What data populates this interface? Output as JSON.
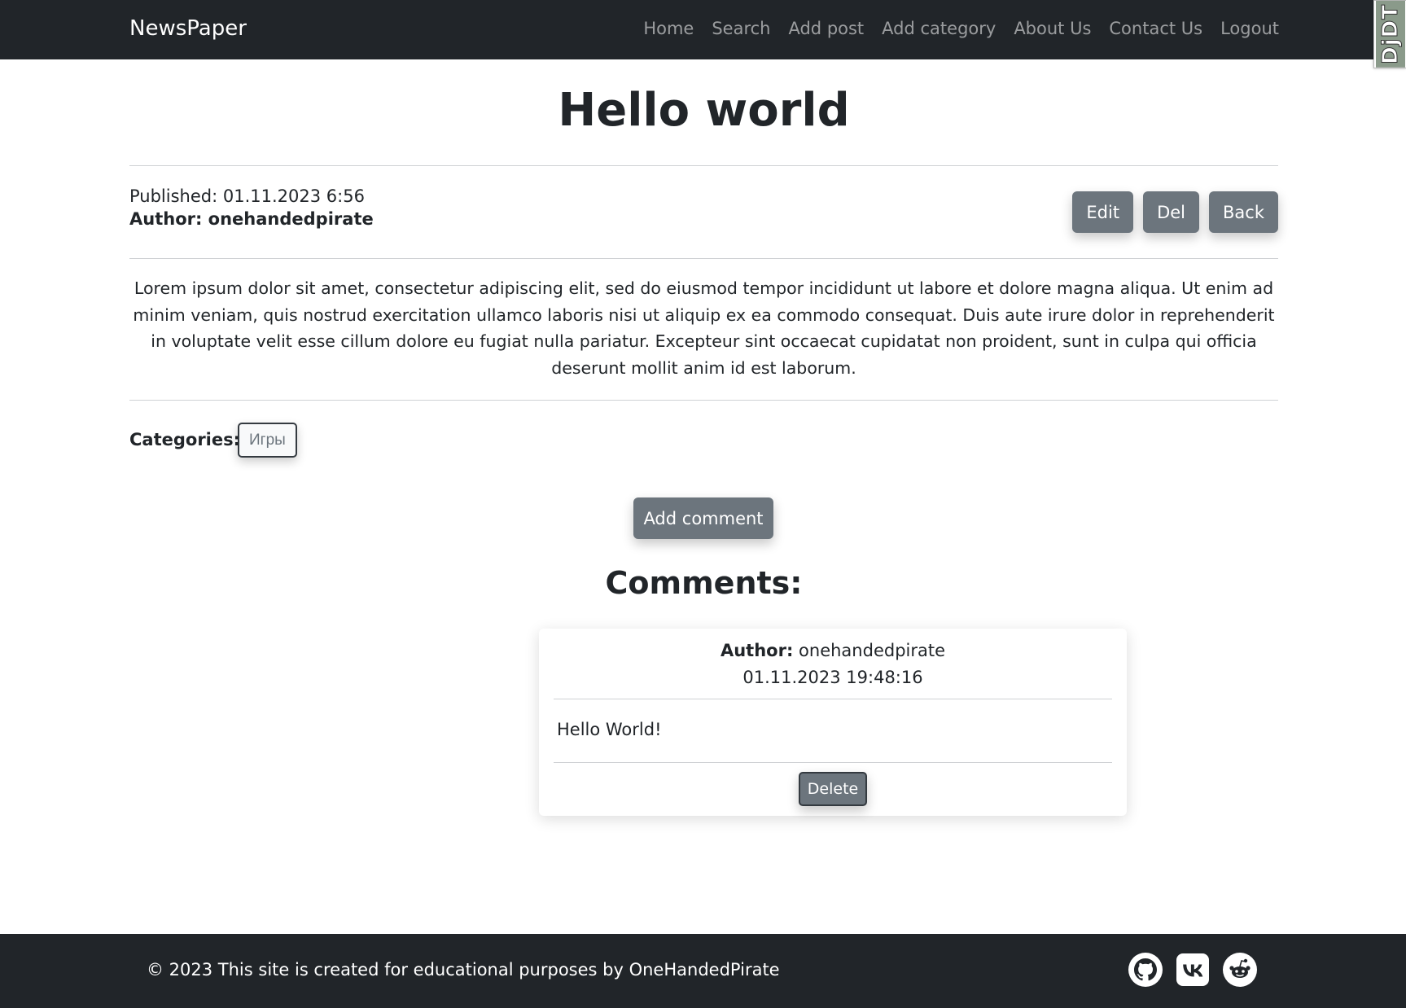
{
  "navbar": {
    "brand": "NewsPaper",
    "links": [
      "Home",
      "Search",
      "Add post",
      "Add category",
      "About Us",
      "Contact Us",
      "Logout"
    ],
    "debug_toolbar_label": "DjDT"
  },
  "post": {
    "title": "Hello world",
    "published": "Published: 01.11.2023 6:56",
    "author": "Author: onehandedpirate",
    "actions": {
      "edit": "Edit",
      "delete": "Del",
      "back": "Back"
    },
    "body": "Lorem ipsum dolor sit amet, consectetur adipiscing elit, sed do eiusmod tempor incididunt ut labore et dolore magna aliqua. Ut enim ad minim veniam, quis nostrud exercitation ullamco laboris nisi ut aliquip ex ea commodo consequat. Duis aute irure dolor in reprehenderit in voluptate velit esse cillum dolore eu fugiat nulla pariatur. Excepteur sint occaecat cupidatat non proident, sunt in culpa qui officia deserunt mollit anim id est laborum.",
    "categories_label": "Categories:",
    "categories": [
      "Игры"
    ],
    "add_comment": "Add comment"
  },
  "comments": {
    "title": "Comments:",
    "items": [
      {
        "author_label": "Author:",
        "author": "onehandedpirate",
        "date": "01.11.2023 19:48:16",
        "text": "Hello World!",
        "delete_label": "Delete"
      }
    ]
  },
  "footer": {
    "text": "© 2023 This site is created for educational purposes by OneHandedPirate",
    "socials": [
      "github-icon",
      "vk-icon",
      "reddit-icon"
    ]
  },
  "colors": {
    "navbar_bg": "#212529",
    "button_bg": "#6c757d",
    "text": "#212529"
  }
}
